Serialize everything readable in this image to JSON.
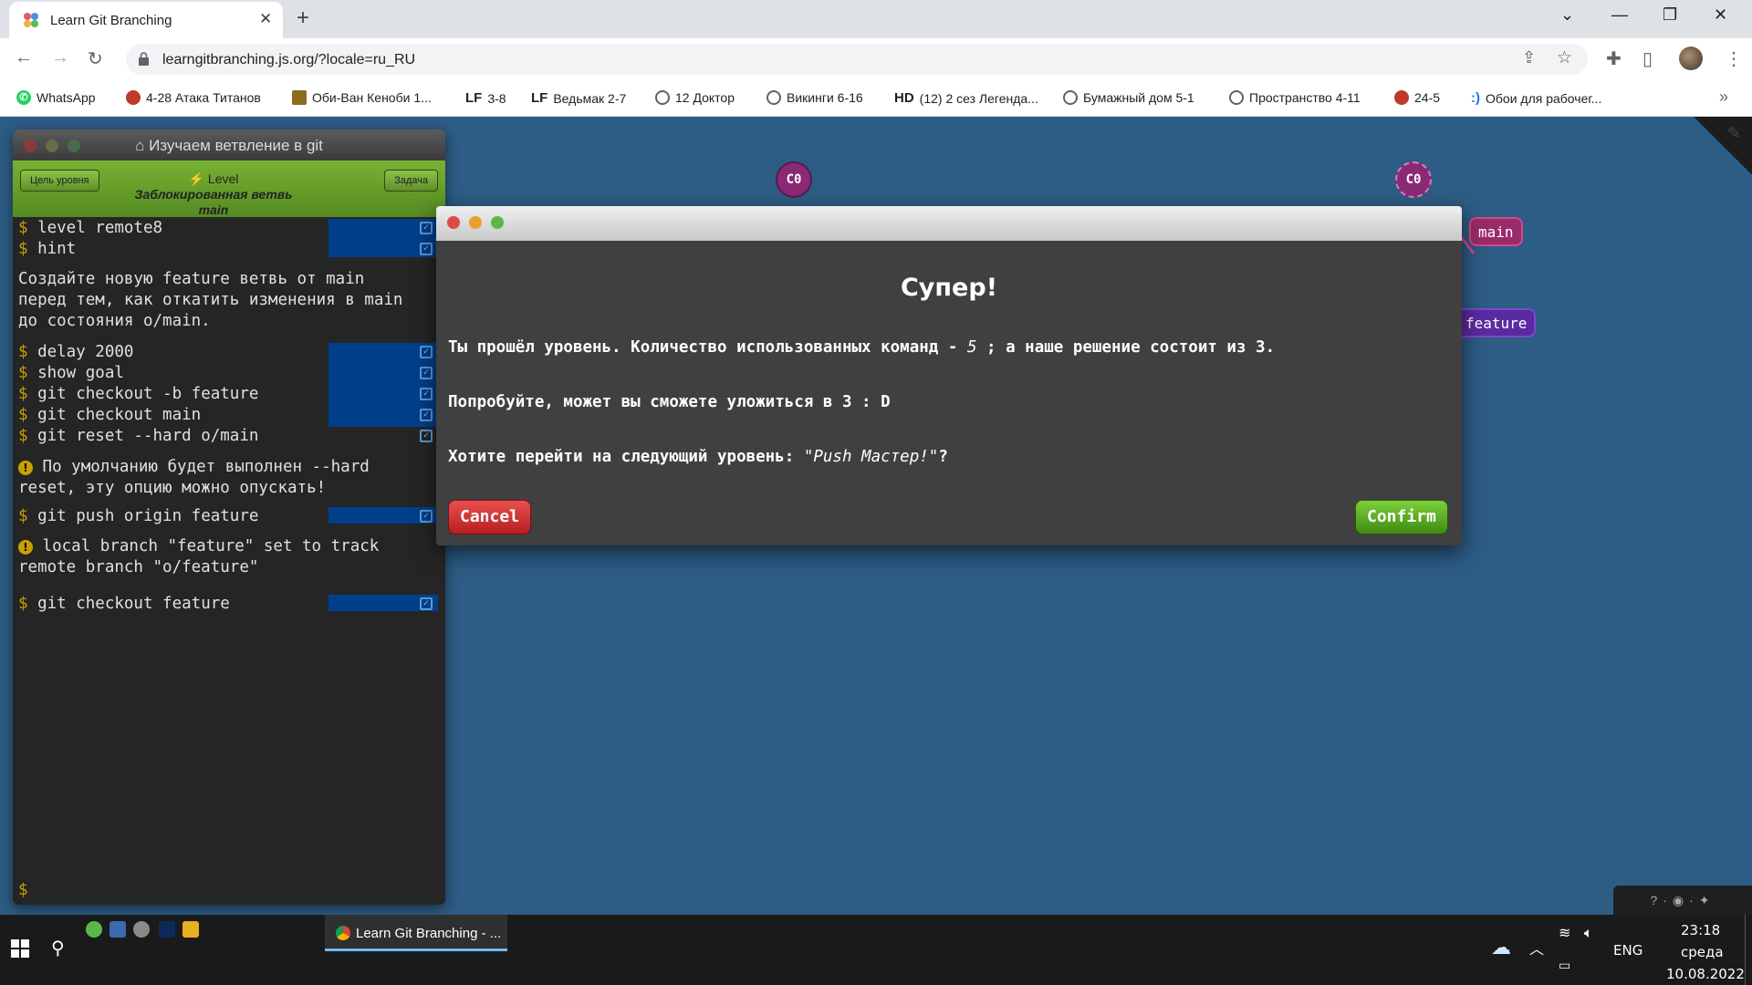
{
  "browser": {
    "tab_title": "Learn Git Branching",
    "url": "learngitbranching.js.org/?locale=ru_RU",
    "bookmarks": [
      {
        "label": "WhatsApp",
        "icon": "whatsapp-icon",
        "color": "#25d366"
      },
      {
        "label": "4-28 Атака Титанов",
        "icon": "anime-icon",
        "color": "#c0392b"
      },
      {
        "label": "Оби-Ван Кеноби 1...",
        "icon": "chart-icon",
        "color": "#8b6d1e"
      },
      {
        "label": "3-8",
        "icon": "lf-icon",
        "tag": "LF"
      },
      {
        "label": "Ведьмак 2-7",
        "icon": "lf-icon",
        "tag": "LF"
      },
      {
        "label": "12 Доктор",
        "icon": "globe-icon",
        "color": "#5f6368"
      },
      {
        "label": "Викинги 6-16",
        "icon": "globe-icon",
        "color": "#5f6368"
      },
      {
        "label": "(12) 2 сез Легенда...",
        "icon": "hd-icon",
        "tag": "HD"
      },
      {
        "label": "Бумажный дом 5-1",
        "icon": "globe-icon",
        "color": "#5f6368"
      },
      {
        "label": "Пространство 4-11",
        "icon": "globe-icon",
        "color": "#5f6368"
      },
      {
        "label": "24-5",
        "icon": "anime-icon",
        "color": "#c0392b"
      },
      {
        "label": "Обои для рабочег...",
        "icon": "smile-icon",
        "color": "#1a73e8",
        "tag": ":)"
      }
    ]
  },
  "terminal": {
    "title": "Изучаем ветвление в git",
    "btn_goal": "Цель уровня",
    "btn_task": "Задача",
    "level_prefix": "Level",
    "level_name": "Заблокированная ветвь main",
    "lines": {
      "l1": "level remote8",
      "l2": "hint",
      "hint1": "Создайте новую feature ветвь от main",
      "hint2": "перед тем, как откатить изменения в main",
      "hint3": "до состояния o/main.",
      "l3": "delay 2000",
      "l4": "show goal",
      "l5": "git checkout -b feature",
      "l6": "git checkout main",
      "l7": "git reset --hard o/main",
      "warn1a": "По умолчанию будет выполнен --hard",
      "warn1b": "reset, эту опцию можно опускать!",
      "l8": "git push origin feature",
      "warn2a": "local branch \"feature\" set to track",
      "warn2b": "remote branch \"o/feature\"",
      "l9": "git checkout feature"
    },
    "prompt": "$"
  },
  "graph": {
    "node_left": "C0",
    "node_right": "C0",
    "branch_main": "main",
    "branch_feature": "feature"
  },
  "modal": {
    "heading": "Супер!",
    "line1_a": "Ты прошёл уровень. Количество использованных команд - ",
    "line1_count": "5",
    "line1_b": " ; а наше решение состоит из 3.",
    "line2": "Попробуйте, может вы сможете уложиться в 3 : D",
    "line3_a": "Хотите перейти на следующий уровень: ",
    "line3_level": "\"Push Мастер!\"",
    "line3_b": "?",
    "cancel": "Cancel",
    "confirm": "Confirm"
  },
  "taskbar": {
    "app_title": "Learn Git Branching - ...",
    "lang": "ENG",
    "time": "23:18",
    "day": "среда",
    "date": "10.08.2022"
  },
  "colors": {
    "page_bg": "#2d5c84",
    "confirm": "#4c9a1a",
    "cancel": "#c8282a",
    "node": "#8a2a74"
  }
}
